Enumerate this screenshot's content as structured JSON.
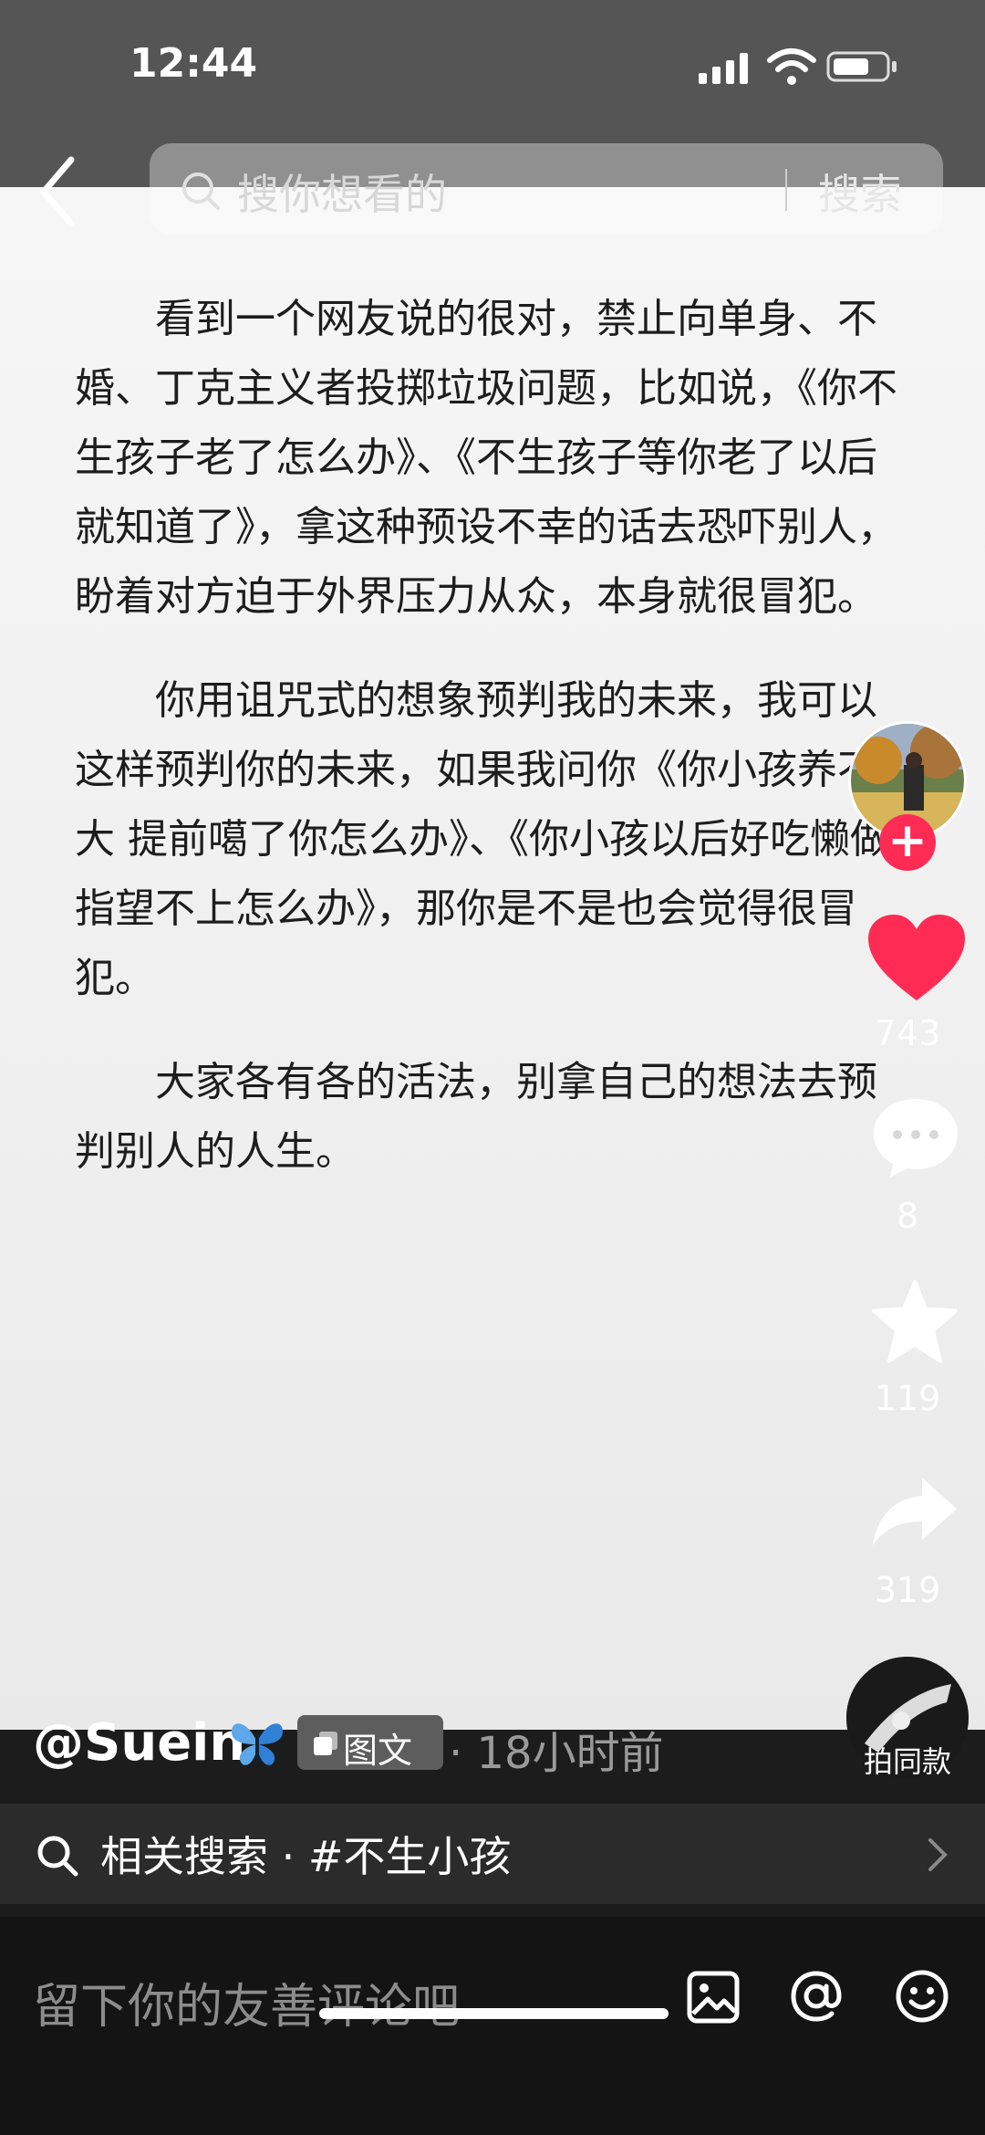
{
  "status_bar": {
    "time": "12:44"
  },
  "search": {
    "placeholder": "搜你想看的",
    "button": "搜索"
  },
  "article": {
    "paragraphs": [
      "看到一个网友说的很对，禁止向单身、不婚、丁克主义者投掷垃圾问题，比如说，《你不生孩子老了怎么办》、《不生孩子等你老了以后就知道了》，拿这种预设不幸的话去恐吓别人，盼着对方迫于外界压力从众，本身就很冒犯。",
      "你用诅咒式的想象预判我的未来，我可以这样预判你的未来，如果我问你《你小孩养不大 提前噶了你怎么办》、《你小孩以后好吃懒做指望不上怎么办》，那你是不是也会觉得很冒犯。",
      "大家各有各的活法，别拿自己的想法去预判别人的人生。"
    ]
  },
  "actions": {
    "follow": "+",
    "likes": "743",
    "comments": "8",
    "favorites": "119",
    "shares": "319",
    "same_style": "拍同款"
  },
  "post": {
    "author": "@Suein",
    "type": "图文",
    "time_ago": "· 18小时前"
  },
  "related": {
    "text": "相关搜索 · #不生小孩"
  },
  "comment": {
    "placeholder": "留下你的友善评论吧"
  },
  "colors": {
    "accent": "#fe2c55",
    "status_bar": "#555555",
    "card": "#f3f3f3"
  }
}
